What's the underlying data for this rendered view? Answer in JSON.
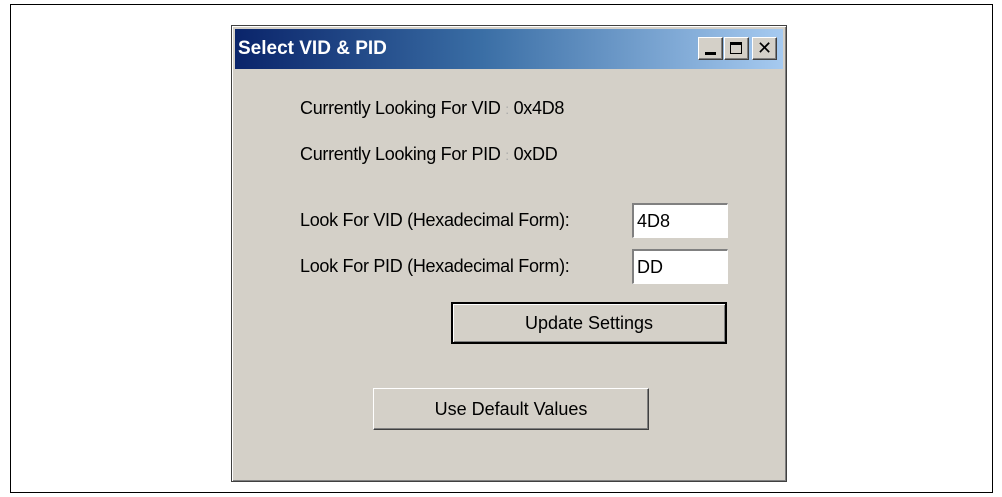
{
  "window": {
    "title": "Select VID & PID",
    "title_buttons": {
      "minimize": "minimize-icon",
      "maximize": "maximize-icon",
      "close": "✕"
    }
  },
  "status": {
    "vid_label": "Currently Looking For VID",
    "vid_separator": ":",
    "vid_value": "0x4D8",
    "pid_label": "Currently Looking For PID",
    "pid_separator": ":",
    "pid_value": "0xDD"
  },
  "form": {
    "vid_label": "Look For VID (Hexadecimal Form):",
    "vid_value": "4D8",
    "pid_label": "Look For PID (Hexadecimal Form):",
    "pid_value": "DD"
  },
  "buttons": {
    "update": "Update Settings",
    "defaults": "Use Default Values"
  },
  "colors": {
    "window_bg": "#d4d0c8",
    "title_start": "#0a246a",
    "title_end": "#a6caf0"
  }
}
